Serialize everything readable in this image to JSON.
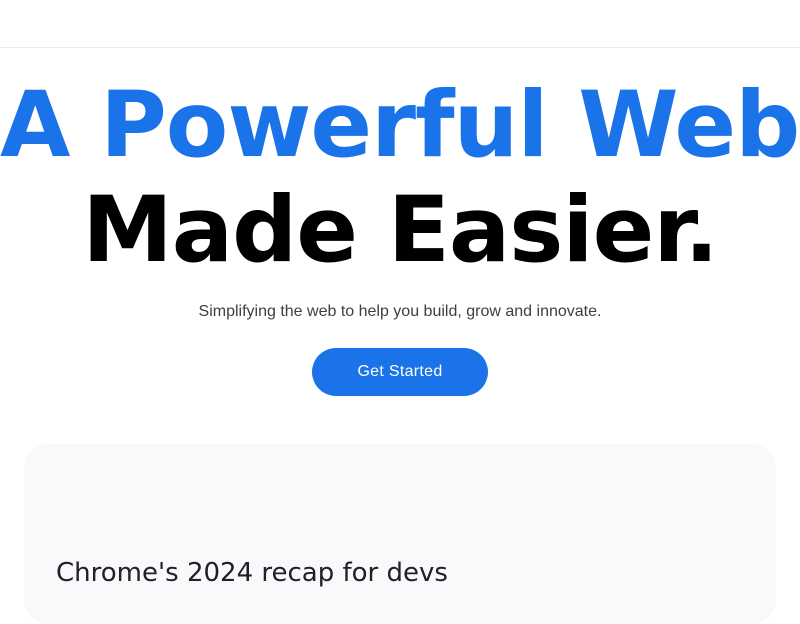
{
  "hero": {
    "line1": "A Powerful Web.",
    "line2": "Made Easier.",
    "subtitle": "Simplifying the web to help you build, grow and innovate.",
    "cta_label": "Get Started"
  },
  "card": {
    "title": "Chrome's 2024 recap for devs"
  },
  "colors": {
    "accent": "#1a73e8",
    "headline_dark": "#000000",
    "card_background": "#f8f9fa"
  }
}
